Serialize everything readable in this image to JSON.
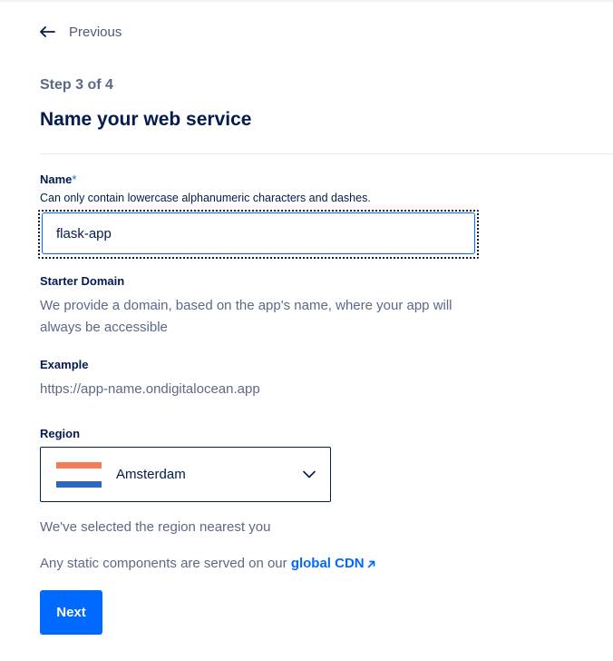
{
  "nav": {
    "previous_label": "Previous"
  },
  "header": {
    "step": "Step 3 of 4",
    "title": "Name your web service"
  },
  "name_field": {
    "label": "Name",
    "required_marker": "*",
    "hint": "Can only contain lowercase alphanumeric characters and dashes.",
    "value": "flask-app"
  },
  "starter_domain": {
    "label": "Starter Domain",
    "description": "We provide a domain, based on the app's name, where your app will always be accessible"
  },
  "example": {
    "label": "Example",
    "url": "https://app-name.ondigitalocean.app"
  },
  "region": {
    "label": "Region",
    "selected": "Amsterdam",
    "flag_icon": "netherlands-flag-icon",
    "note": "We've selected the region nearest you"
  },
  "cdn": {
    "text": "Any static components are served on our ",
    "link_label": "global CDN",
    "link_icon": "external-arrow-icon"
  },
  "actions": {
    "next_label": "Next"
  },
  "colors": {
    "accent": "#0069ff",
    "text_dark": "#031b4e",
    "text_muted": "#5b6987",
    "flag_red": "#f27c5a",
    "flag_blue": "#2b66c0"
  }
}
